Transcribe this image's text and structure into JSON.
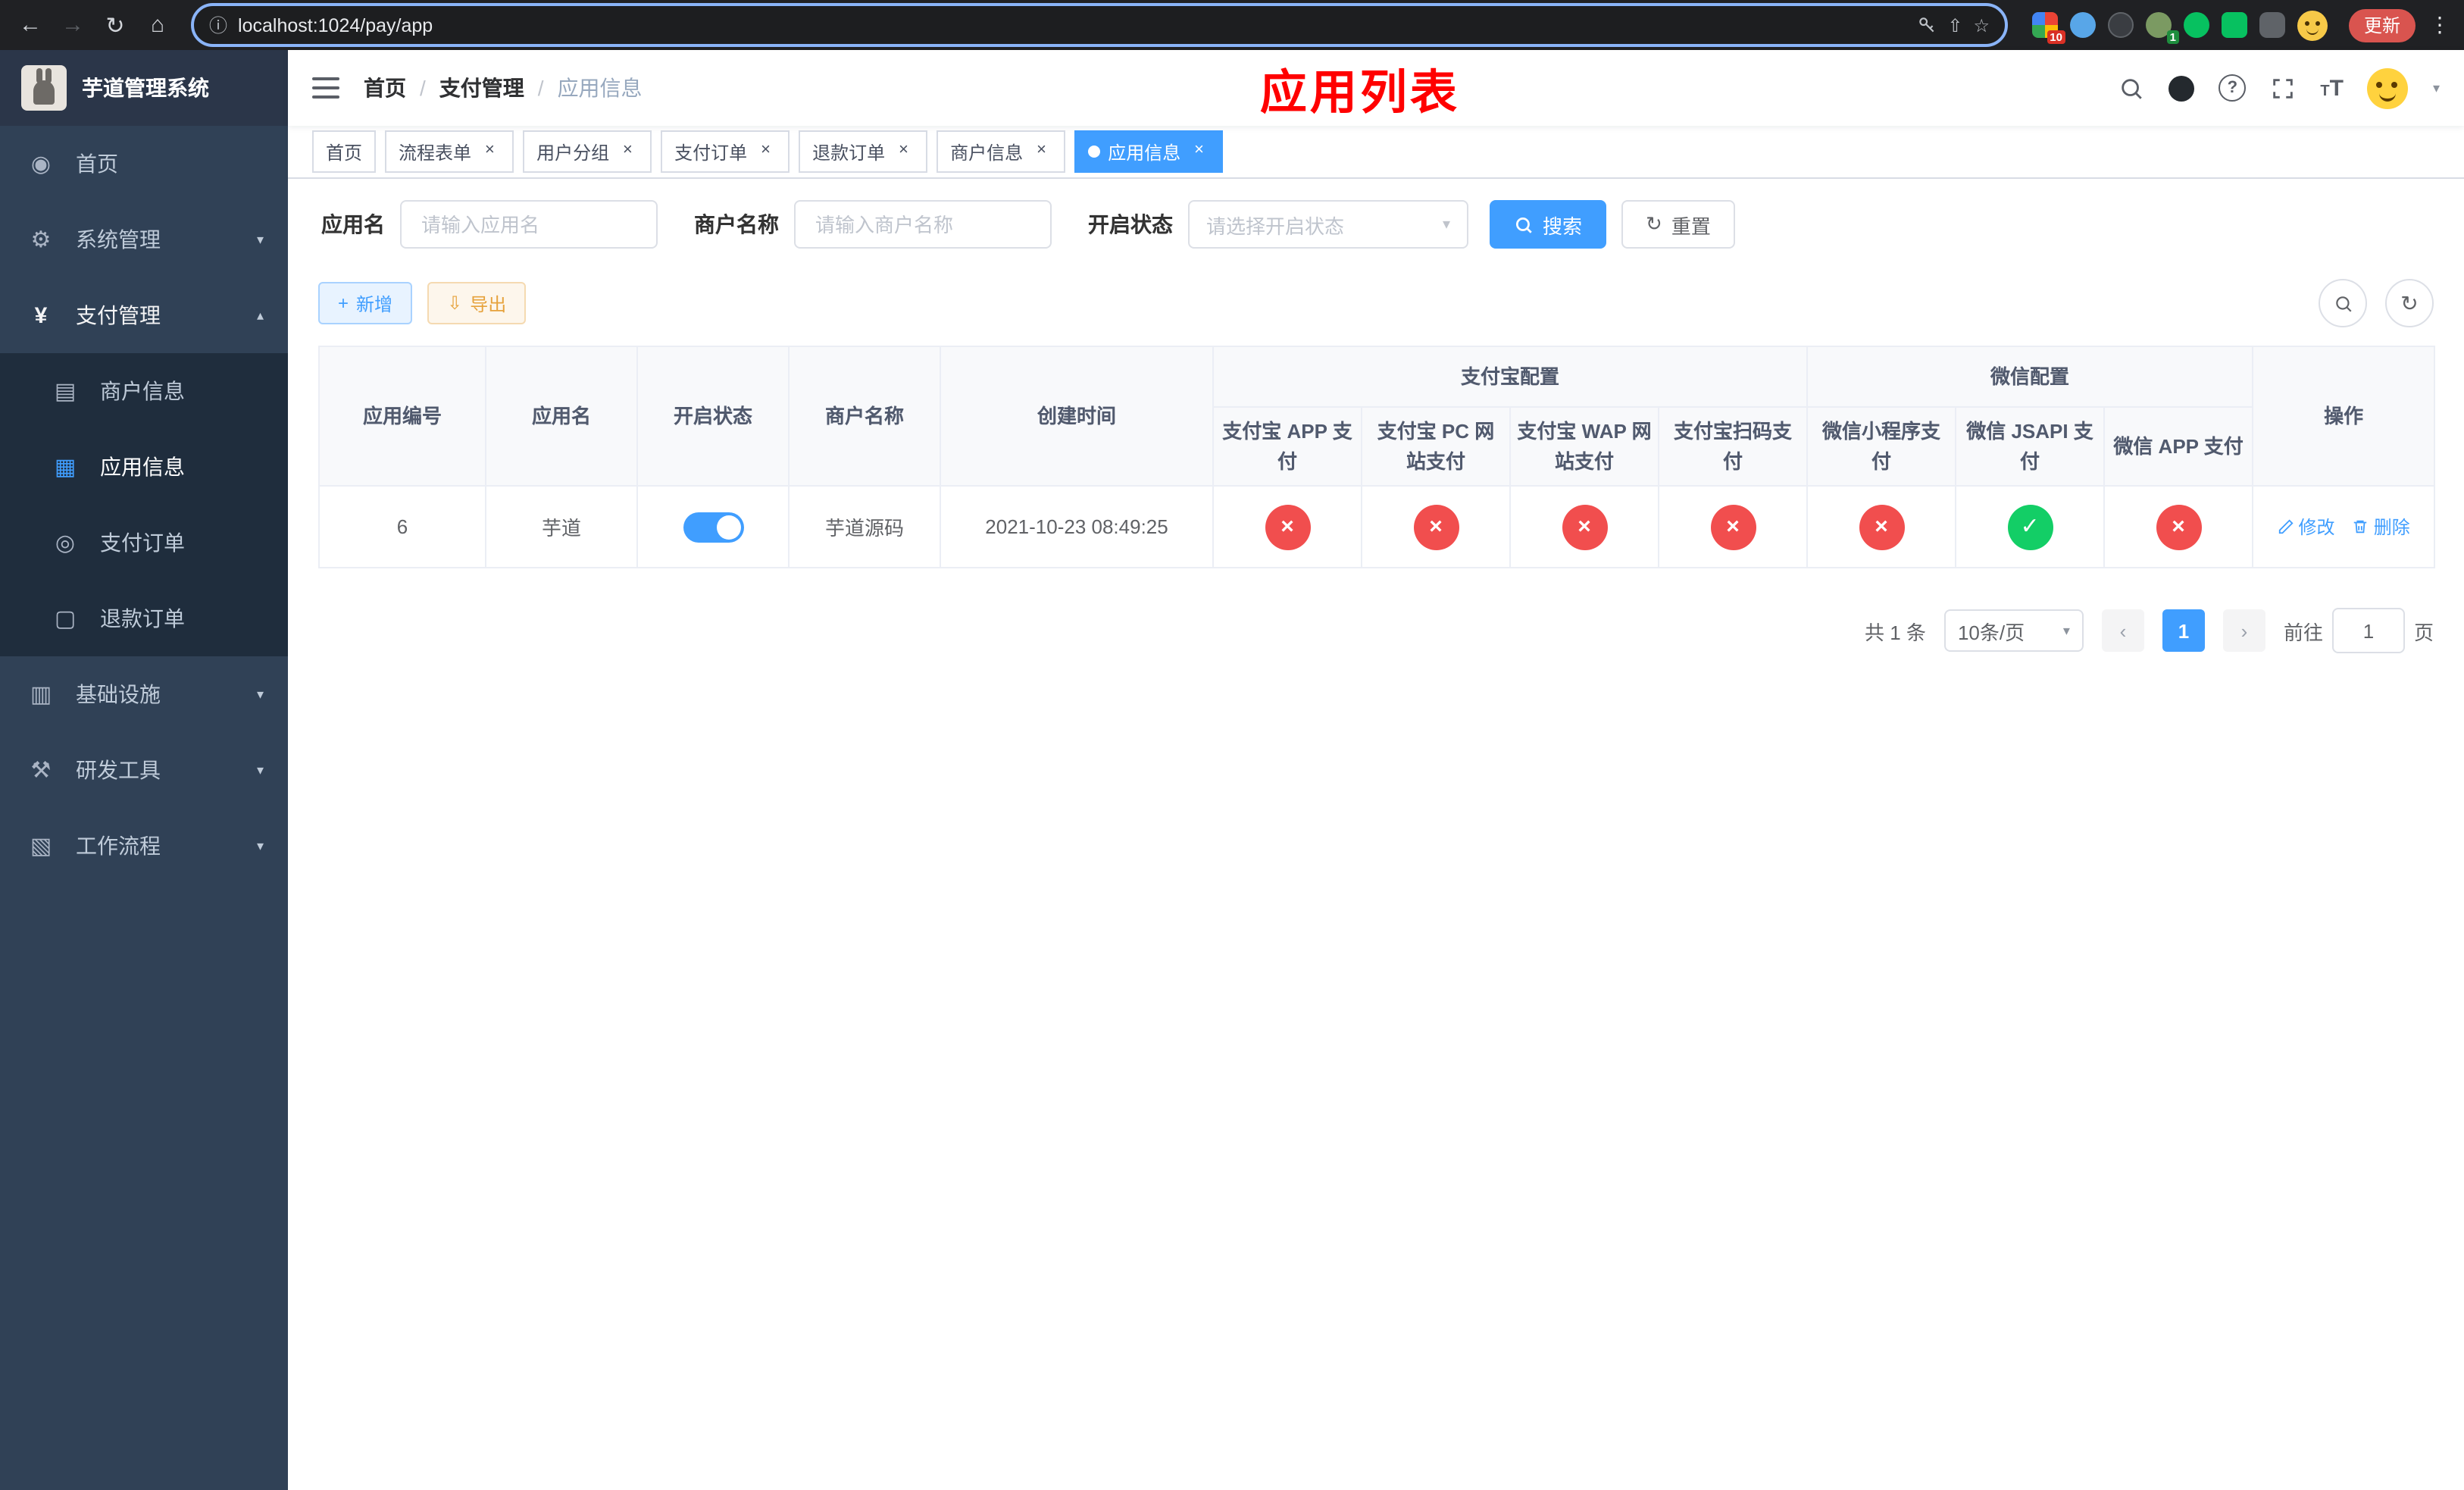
{
  "browser": {
    "url": "localhost:1024/pay/app",
    "update_label": "更新",
    "ext_badge_count": "10",
    "profile_badge_count": "1"
  },
  "icons": {
    "back": "←",
    "forward": "→",
    "reload": "↻",
    "home": "⌂",
    "info": "ⓘ",
    "share": "⇧",
    "star": "☆",
    "menu_dots": "⋮",
    "close": "×",
    "caret_down": "▾",
    "chevron_down": "▾",
    "chevron_up": "▴",
    "check": "✓",
    "cross": "×",
    "dashboard": "◉",
    "gear": "⚙",
    "yen": "¥",
    "merchant": "▤",
    "app_grid": "▦",
    "pay_order": "◎",
    "refund_order": "▢",
    "infra": "▥",
    "devtools": "⚒",
    "workflow": "▧",
    "reset": "↻",
    "question": "?"
  },
  "sidebar": {
    "title": "芋道管理系统",
    "items": {
      "home": "首页",
      "system": "系统管理",
      "pay": "支付管理",
      "infra": "基础设施",
      "dev": "研发工具",
      "workflow": "工作流程"
    },
    "pay_children": {
      "merchant": "商户信息",
      "app": "应用信息",
      "order": "支付订单",
      "refund": "退款订单"
    }
  },
  "navbar": {
    "breadcrumb": {
      "home": "首页",
      "section": "支付管理",
      "current": "应用信息"
    },
    "overlay_title": "应用列表"
  },
  "tabs": [
    {
      "label": "首页",
      "closable": false,
      "active": false
    },
    {
      "label": "流程表单",
      "closable": true,
      "active": false
    },
    {
      "label": "用户分组",
      "closable": true,
      "active": false
    },
    {
      "label": "支付订单",
      "closable": true,
      "active": false
    },
    {
      "label": "退款订单",
      "closable": true,
      "active": false
    },
    {
      "label": "商户信息",
      "closable": true,
      "active": false
    },
    {
      "label": "应用信息",
      "closable": true,
      "active": true
    }
  ],
  "filters": {
    "app_name_label": "应用名",
    "app_name_placeholder": "请输入应用名",
    "merchant_label": "商户名称",
    "merchant_placeholder": "请输入商户名称",
    "status_label": "开启状态",
    "status_placeholder": "请选择开启状态",
    "search_label": "搜索",
    "reset_label": "重置"
  },
  "toolbar": {
    "add_label": "新增",
    "export_label": "导出"
  },
  "table": {
    "headers": {
      "app_id": "应用编号",
      "app_name": "应用名",
      "status": "开启状态",
      "merchant": "商户名称",
      "created": "创建时间",
      "alipay_group": "支付宝配置",
      "wechat_group": "微信配置",
      "alipay_app": "支付宝 APP 支付",
      "alipay_pc": "支付宝 PC 网站支付",
      "alipay_wap": "支付宝 WAP 网站支付",
      "alipay_qr": "支付宝扫码支付",
      "wx_mini": "微信小程序支付",
      "wx_jsapi": "微信 JSAPI 支付",
      "wx_app": "微信 APP 支付",
      "actions": "操作"
    },
    "rows": [
      {
        "id": "6",
        "name": "芋道",
        "enabled": true,
        "merchant": "芋道源码",
        "created": "2021-10-23 08:49:25",
        "configs": [
          false,
          false,
          false,
          false,
          false,
          true,
          false
        ],
        "edit_label": "修改",
        "delete_label": "删除"
      }
    ]
  },
  "pagination": {
    "total_text": "共 1 条",
    "page_size_text": "10条/页",
    "prev": "‹",
    "next": "›",
    "current_page": "1",
    "goto_prefix": "前往",
    "goto_page": "1",
    "goto_suffix": "页"
  },
  "colors": {
    "primary": "#409eff",
    "danger": "#f14e4e",
    "success": "#13ce66",
    "warning": "#e6a23c",
    "sidebar_bg": "#304156",
    "submenu_bg": "#1f2d3d",
    "annotation_red": "#ff0000"
  }
}
